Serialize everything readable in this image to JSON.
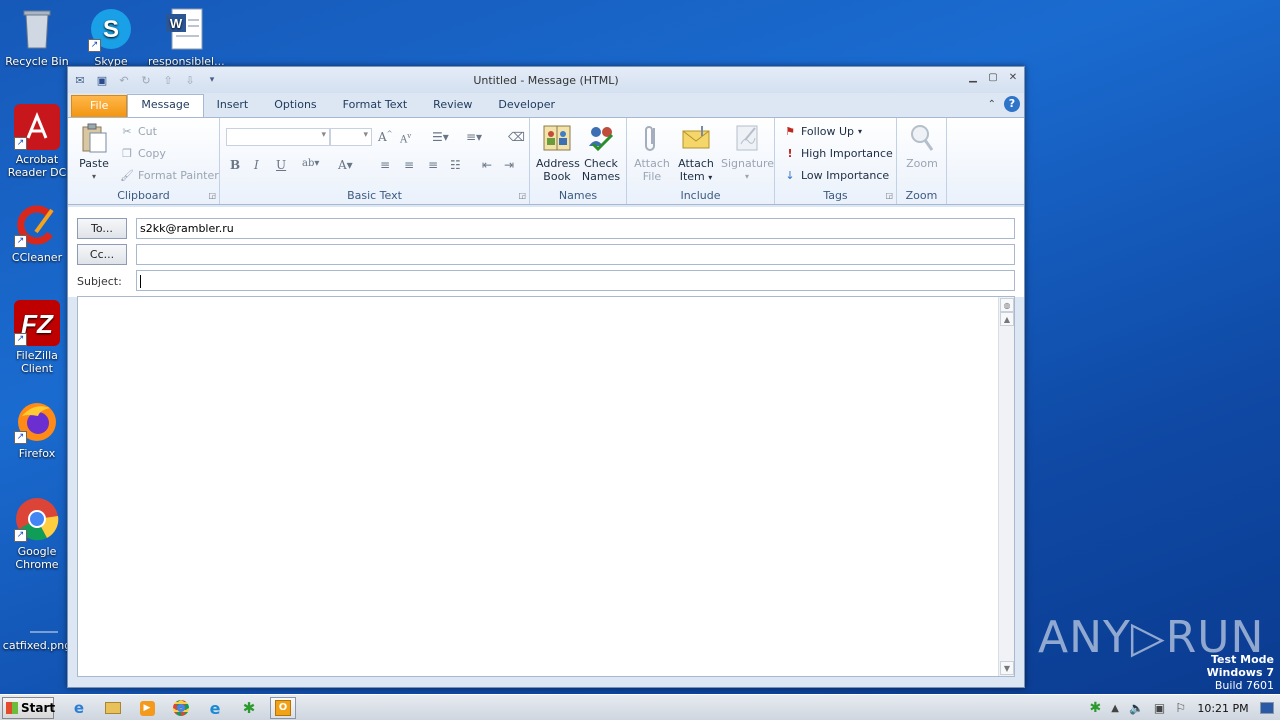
{
  "desktop": {
    "icons": [
      {
        "name": "recycle-bin",
        "label": "Recycle Bin"
      },
      {
        "name": "skype",
        "label": "Skype"
      },
      {
        "name": "word-doc",
        "label": "responsiblel..."
      },
      {
        "name": "acrobat",
        "label": "Acrobat Reader DC"
      },
      {
        "name": "ccleaner",
        "label": "CCleaner"
      },
      {
        "name": "filezilla",
        "label": "FileZilla Client"
      },
      {
        "name": "firefox",
        "label": "Firefox"
      },
      {
        "name": "chrome",
        "label": "Google Chrome"
      },
      {
        "name": "catfixed",
        "label": "catfixed.png"
      }
    ]
  },
  "window": {
    "title": "Untitled -  Message (HTML)"
  },
  "tabs": [
    "File",
    "Message",
    "Insert",
    "Options",
    "Format Text",
    "Review",
    "Developer"
  ],
  "ribbon": {
    "clipboard": {
      "paste": "Paste",
      "cut": "Cut",
      "copy": "Copy",
      "format_painter": "Format Painter",
      "label": "Clipboard"
    },
    "basic_text": {
      "label": "Basic Text"
    },
    "names": {
      "address_book": "Address Book",
      "check_names": "Check Names",
      "label": "Names"
    },
    "include": {
      "attach_file": "Attach File",
      "attach_item": "Attach Item",
      "signature": "Signature",
      "label": "Include"
    },
    "tags": {
      "follow_up": "Follow Up",
      "high_importance": "High Importance",
      "low_importance": "Low Importance",
      "label": "Tags"
    },
    "zoom": {
      "zoom": "Zoom",
      "label": "Zoom"
    }
  },
  "fields": {
    "to_button": "To...",
    "to_value": "s2kk@rambler.ru",
    "cc_button": "Cc...",
    "cc_value": "",
    "subject_label": "Subject:",
    "subject_value": ""
  },
  "taskbar": {
    "start": "Start",
    "clock": "10:21 PM"
  },
  "watermark": {
    "line1": "Test Mode",
    "line2": "Windows 7",
    "line3": "Build 7601",
    "brand": "ANY▷RUN"
  }
}
